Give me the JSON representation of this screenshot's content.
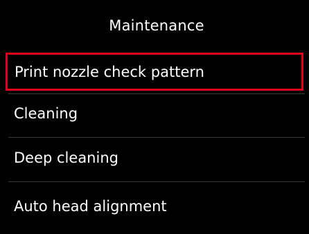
{
  "screen": {
    "title": "Maintenance",
    "accent_color": "#e0001a",
    "background_color": "#000000",
    "text_color": "#ffffff"
  },
  "menu": {
    "selected_index": 0,
    "items": [
      {
        "label": "Print nozzle check pattern"
      },
      {
        "label": "Cleaning"
      },
      {
        "label": "Deep cleaning"
      },
      {
        "label": "Auto head alignment"
      }
    ]
  }
}
